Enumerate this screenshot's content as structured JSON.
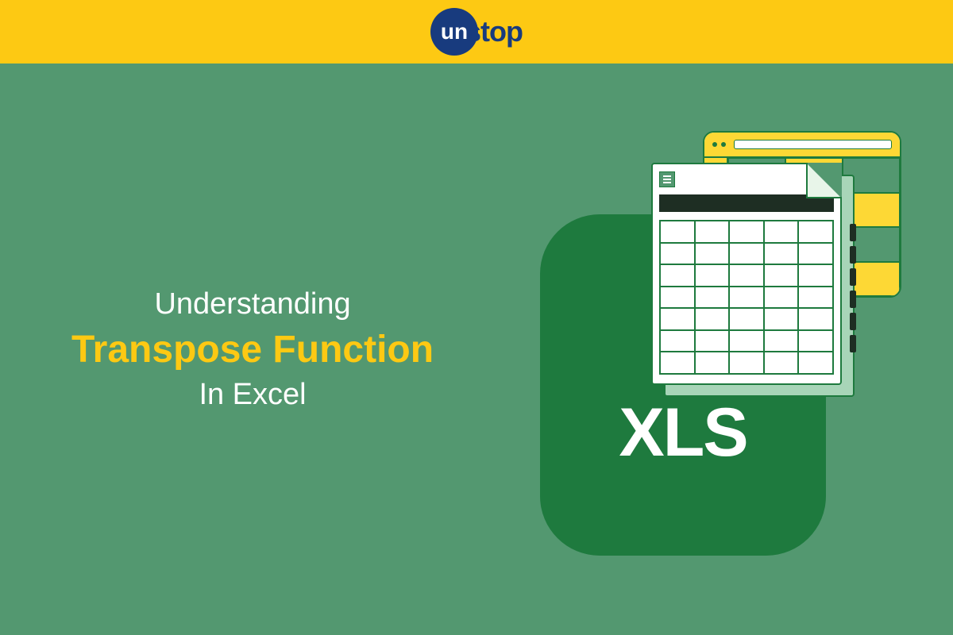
{
  "logo": {
    "badge_text": "un",
    "suffix_text": "stop"
  },
  "title": {
    "line1": "Understanding",
    "line2": "Transpose Function",
    "line3": "In Excel"
  },
  "illustration": {
    "file_label": "XLS"
  }
}
